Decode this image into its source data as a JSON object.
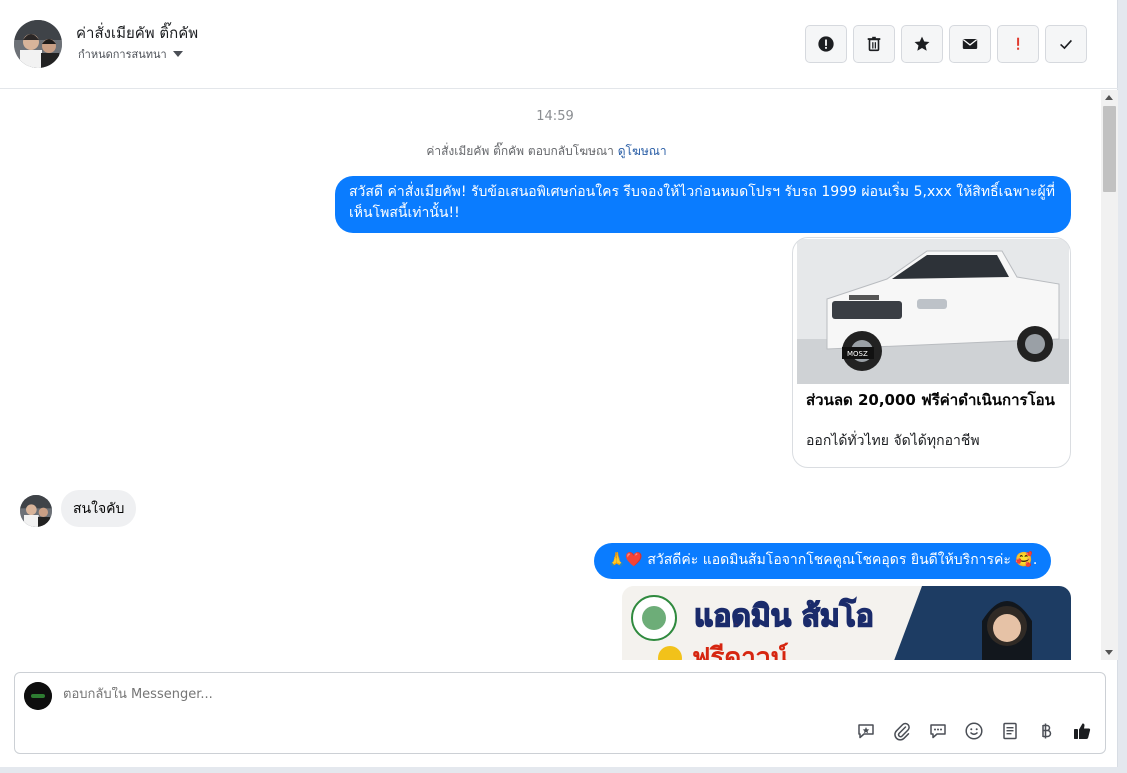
{
  "header": {
    "contact_name": "ค่าสั่งเมียคัพ ติ๊กคัพ",
    "assign_label": "กำหนดการสนทนา",
    "actions": [
      {
        "name": "mark-spam-button",
        "icon": "exclamation-circle-icon"
      },
      {
        "name": "delete-button",
        "icon": "trash-icon"
      },
      {
        "name": "star-button",
        "icon": "star-icon"
      },
      {
        "name": "mark-unread-button",
        "icon": "envelope-icon"
      },
      {
        "name": "follow-up-button",
        "icon": "exclamation-icon",
        "color": "#e03a2f"
      },
      {
        "name": "mark-done-button",
        "icon": "checkmark-icon"
      }
    ]
  },
  "thread": {
    "time": "14:59",
    "reply_note_prefix": "ค่าสั่งเมียคัพ ติ๊กคัพ ตอบกลับโฆษณา",
    "reply_note_link": "ดูโฆษณา",
    "msg1": "สวัสดี ค่าสั่งเมียคัพ! รับข้อเสนอพิเศษก่อนใคร รีบจองให้ไวก่อนหมดโปรฯ รับรถ 1999 ผ่อนเริ่ม 5,xxx ให้สิทธิ์เฉพาะผู้ที่เห็นโพสนี้เท่านั้น!!",
    "card": {
      "image": "pickup-truck-photo",
      "plate_text": "MOSZ",
      "title": "ส่วนลด 20,000 ฟรีค่าดำเนินการโอน",
      "subtitle": "ออกได้ทั่วไทย จัดได้ทุกอาชีพ"
    },
    "incoming": "สนใจคับ",
    "msg2_emoji": "🙏❤️",
    "msg2": "สวัสดีค่ะ แอดมินส้มโอจากโชคคูณโชคอุดร ยินดีให้บริการค่ะ",
    "msg2_tail_emoji": "🥰.",
    "banner": {
      "text": "แอดมิน ส้มโอ",
      "sub": "ฟรีดาวน์"
    }
  },
  "composer": {
    "placeholder": "ตอบกลับใน Messenger...",
    "tools": [
      "saved-reply-icon",
      "paperclip-icon",
      "chat-bubbles-icon",
      "emoji-icon",
      "notes-icon",
      "baht-icon",
      "thumbs-up-icon"
    ]
  },
  "colors": {
    "accent": "#0a7cff",
    "follow_up": "#e03a2f"
  }
}
